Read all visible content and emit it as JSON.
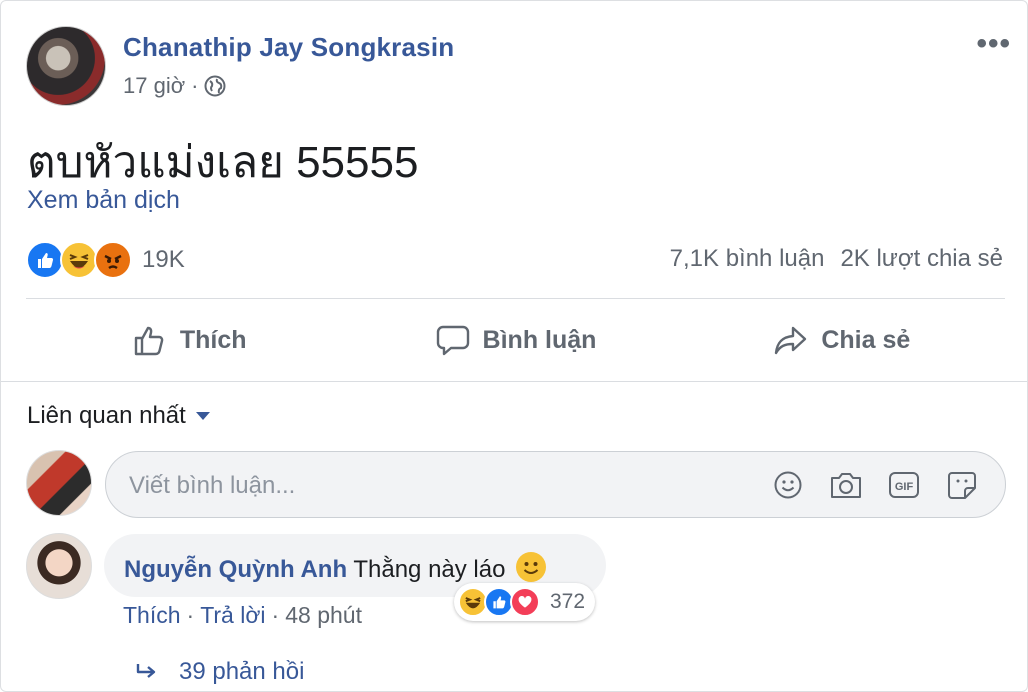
{
  "post": {
    "author": "Chanathip Jay Songkrasin",
    "time": "17 giờ",
    "separator": "·",
    "text": "ตบหัวแม่งเลย 55555",
    "translate_link": "Xem bản dịch",
    "more_label": "•••"
  },
  "summary": {
    "reaction_count": "19K",
    "comments": "7,1K bình luận",
    "shares": "2K lượt chia sẻ",
    "reaction_icons": [
      "like-icon",
      "haha-icon",
      "angry-icon"
    ]
  },
  "actions": {
    "like": "Thích",
    "comment": "Bình luận",
    "share": "Chia sẻ"
  },
  "comments_section": {
    "sort_label": "Liên quan nhất",
    "input_placeholder": "Viết bình luận...",
    "input_icons": [
      "emoji-icon",
      "camera-icon",
      "gif-icon",
      "sticker-icon"
    ]
  },
  "comment": {
    "author": "Nguyễn Quỳnh Anh",
    "text": "Thằng này láo",
    "reaction_count": "372",
    "like_label": "Thích",
    "reply_label": "Trả lời",
    "dot": "·",
    "time": "48 phút",
    "replies_label": "39 phản hồi"
  },
  "colors": {
    "link": "#385898",
    "muted": "#606770",
    "like_blue": "#1877f2",
    "haha_yellow": "#f7c236",
    "angry_orange": "#e9710f",
    "love_red": "#f33e58"
  }
}
